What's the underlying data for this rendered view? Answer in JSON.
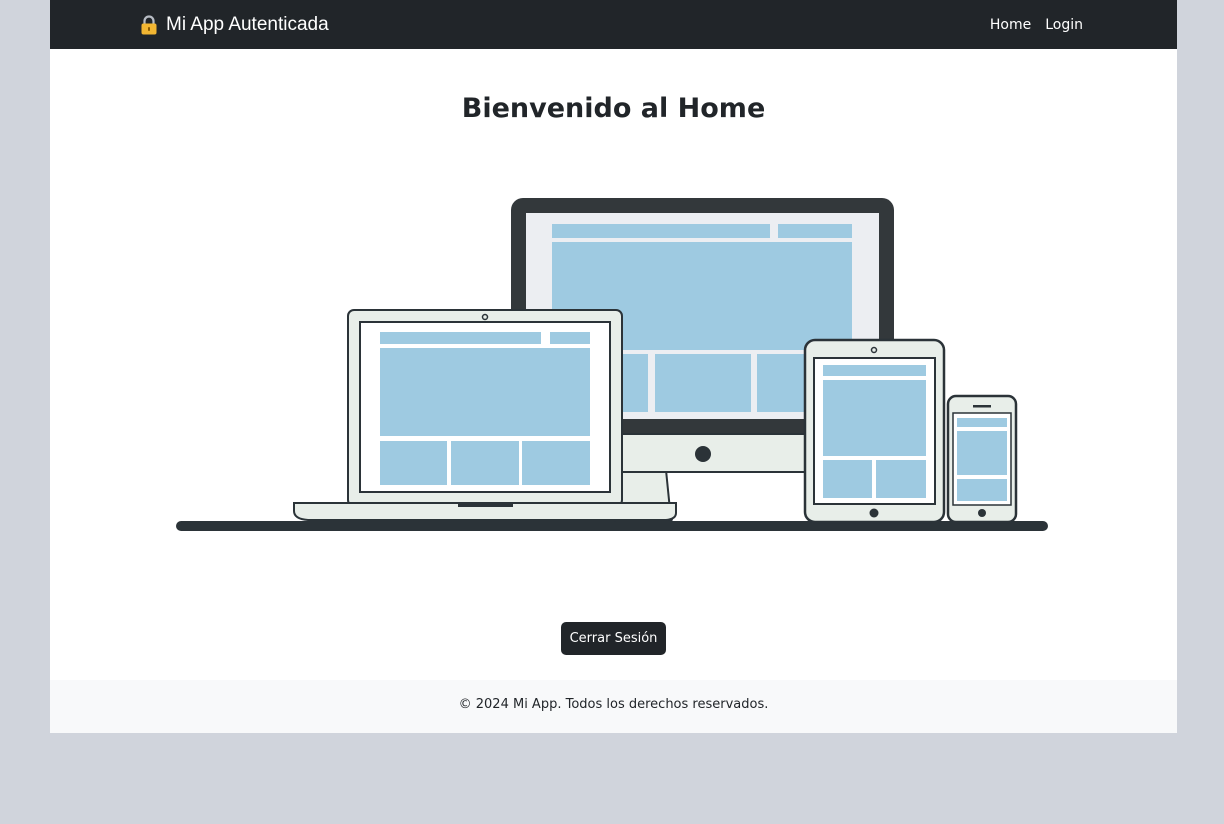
{
  "navbar": {
    "brand_icon": "lock-icon",
    "brand_label": "Mi App Autenticada",
    "links": [
      {
        "label": "Home"
      },
      {
        "label": "Login"
      }
    ]
  },
  "main": {
    "title": "Bienvenido al Home",
    "hero_image": "responsive-devices-illustration",
    "logout_label": "Cerrar Sesión"
  },
  "footer": {
    "text": "© 2024 Mi App. Todos los derechos reservados."
  },
  "colors": {
    "navbar_bg": "#212529",
    "page_bg": "#d0d4dc",
    "footer_bg": "#f8f9fa",
    "screen_blue": "#9ecae1",
    "device_dark": "#2b3338",
    "lock_gold": "#f2b632"
  }
}
